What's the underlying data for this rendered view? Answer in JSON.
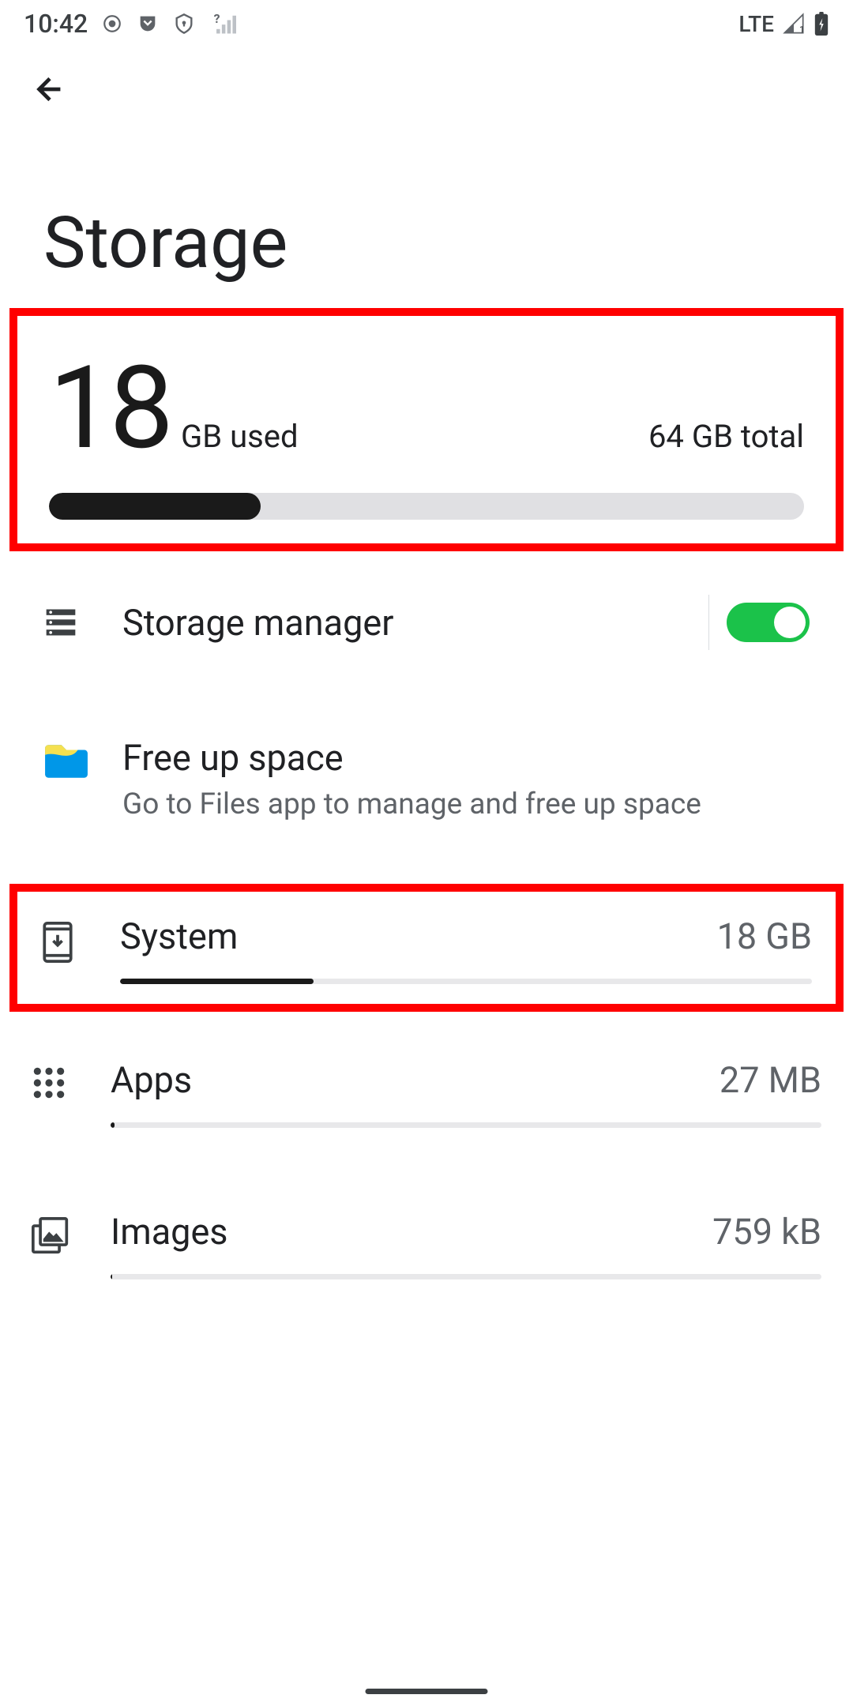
{
  "status_bar": {
    "time": "10:42",
    "network": "LTE"
  },
  "page": {
    "title": "Storage"
  },
  "usage": {
    "used_number": "18",
    "used_label": "GB used",
    "total_label": "64 GB total",
    "progress_percent": 28
  },
  "storage_manager": {
    "label": "Storage manager",
    "enabled": true
  },
  "free_up": {
    "title": "Free up space",
    "subtitle": "Go to Files app to manage and free up space"
  },
  "categories": [
    {
      "name": "System",
      "value": "18 GB",
      "progress_percent": 28
    },
    {
      "name": "Apps",
      "value": "27 MB",
      "progress_percent": 0.5
    },
    {
      "name": "Images",
      "value": "759 kB",
      "progress_percent": 0.2
    }
  ]
}
